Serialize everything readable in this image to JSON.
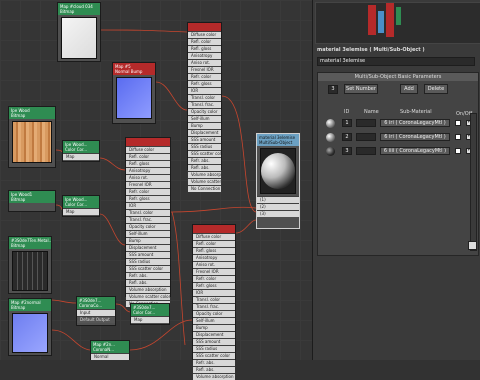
{
  "nodes": {
    "bump": {
      "title": "Map #cloud 034\nBitmap"
    },
    "normal_top": {
      "title": "Map #5\nNormal Bump"
    },
    "wood": {
      "title": "Ipe Wood\nBitmap"
    },
    "wood_cc": {
      "title": "Ipe Wood...\nColor Cor...",
      "slot": "Map"
    },
    "wood2": {
      "title": "Ipe Wood1\nBitmap"
    },
    "wood2_cc": {
      "title": "Ipe Wood...\nColor Cor...",
      "slot": "Map"
    },
    "tex_tile": {
      "title": "#3S0de7Ten.Metal...\nBitmap"
    },
    "tex_normal": {
      "title": "Map #2normal\nBitmap"
    },
    "corona_cc": {
      "title": "#3S0de7...\nCoronaCo...",
      "slot1": "Input",
      "slot2": "Default Output"
    },
    "color_cor": {
      "title": "#3S0de7...\nColor Cor...",
      "slot": "Map"
    },
    "normal_bump": {
      "title": "Map #2n...\nCoronaN...",
      "slot": "Normal"
    },
    "multisub": {
      "title": "material 3elemise\nMulti/Sub-Object",
      "slots": [
        "(1)",
        "(2)",
        "(3)"
      ]
    }
  },
  "mat_slots": [
    "Diffuse color",
    "Refl. color",
    "Refl. gloss",
    "Anisotropy",
    "Aniso rot.",
    "Fresnel IOR",
    "Refr. color",
    "Refr. gloss",
    "IOR",
    "Transl. color",
    "Transl. frac.",
    "Opacity color",
    "Self-illum",
    "Bump",
    "Displacement",
    "SSS amount",
    "SSS radius",
    "SSS scatter color",
    "Refr. abs.",
    "Refl. abs.",
    "Volume absorption",
    "Volume scatter color",
    "No Connection"
  ],
  "panel": {
    "title": "material 3elemise  ( Multi/Sub-Object )",
    "name_value": "material 3elemise",
    "rollout_title": "Multi/Sub-Object Basic Parameters",
    "count": "3",
    "set_number_label": "Set Number",
    "add_label": "Add",
    "delete_label": "Delete",
    "col_id": "ID",
    "col_name": "Name",
    "col_sub": "Sub-Material",
    "col_onoff": "On/Off",
    "rows": [
      {
        "id": "1",
        "sub": "6 iri  ( CoronaLegacyMtl )"
      },
      {
        "id": "2",
        "sub": "6 iri  ( CoronaLegacyMtl )"
      },
      {
        "id": "3",
        "sub": "6 iiii  ( CoronaLegacyMtl )"
      }
    ]
  },
  "colors": {
    "header_green": "#2f8c52",
    "header_blue": "#6ba0c2",
    "wire": "#c8462e",
    "socket": "#e8d020"
  }
}
